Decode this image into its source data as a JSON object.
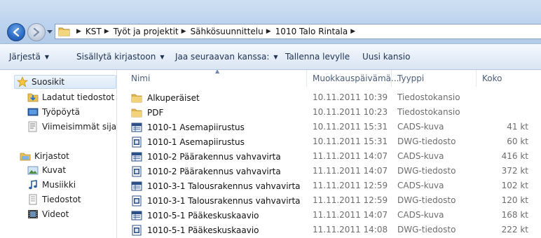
{
  "address": {
    "breadcrumb": [
      "KST",
      "Työt ja projektit",
      "Sähkösuunnittelu",
      "1010 Talo Rintala"
    ]
  },
  "toolbar": {
    "organize": "Järjestä",
    "include": "Sisällytä kirjastoon",
    "share": "Jaa seuraavan kanssa:",
    "burn": "Tallenna levylle",
    "new_folder": "Uusi kansio"
  },
  "nav": {
    "favorites": "Suosikit",
    "downloads": "Ladatut tiedostot",
    "desktop": "Työpöytä",
    "recent": "Viimeisimmät sijainn",
    "libraries": "Kirjastot",
    "pictures": "Kuvat",
    "music": "Musiikki",
    "documents": "Tiedostot",
    "videos": "Videot"
  },
  "columns": {
    "name": "Nimi",
    "modified": "Muokkauspäivämä...",
    "type": "Tyyppi",
    "size": "Koko"
  },
  "files": [
    {
      "name": "Alkuperäiset",
      "date": "10.11.2011 10:39",
      "type": "Tiedostokansio",
      "size": "",
      "icon": "folder-icon"
    },
    {
      "name": "PDF",
      "date": "10.11.2011 10:23",
      "type": "Tiedostokansio",
      "size": "",
      "icon": "folder-icon"
    },
    {
      "name": "1010-1 Asemapiirustus",
      "date": "10.11.2011 15:31",
      "type": "CADS-kuva",
      "size": "41 kt",
      "icon": "cads-file-icon"
    },
    {
      "name": "1010-1 Asemapiirustus",
      "date": "10.11.2011 15:31",
      "type": "DWG-tiedosto",
      "size": "60 kt",
      "icon": "dwg-file-icon"
    },
    {
      "name": "1010-2 Päärakennus vahvavirta",
      "date": "11.11.2011 14:07",
      "type": "CADS-kuva",
      "size": "416 kt",
      "icon": "cads-file-icon"
    },
    {
      "name": "1010-2 Päärakennus vahvavirta",
      "date": "11.11.2011 14:07",
      "type": "DWG-tiedosto",
      "size": "372 kt",
      "icon": "dwg-file-icon"
    },
    {
      "name": "1010-3-1 Talousrakennus vahvavirta",
      "date": "11.11.2011 12:59",
      "type": "CADS-kuva",
      "size": "102 kt",
      "icon": "cads-file-icon"
    },
    {
      "name": "1010-3-1 Talousrakennus vahvavirta",
      "date": "11.11.2011 12:59",
      "type": "DWG-tiedosto",
      "size": "120 kt",
      "icon": "dwg-file-icon"
    },
    {
      "name": "1010-5-1 Pääkeskuskaavio",
      "date": "11.11.2011 14:07",
      "type": "CADS-kuva",
      "size": "168 kt",
      "icon": "cads-file-icon"
    },
    {
      "name": "1010-5-1 Pääkeskuskaavio",
      "date": "11.11.2011 14:08",
      "type": "DWG-tiedosto",
      "size": "222 kt",
      "icon": "dwg-file-icon"
    }
  ]
}
